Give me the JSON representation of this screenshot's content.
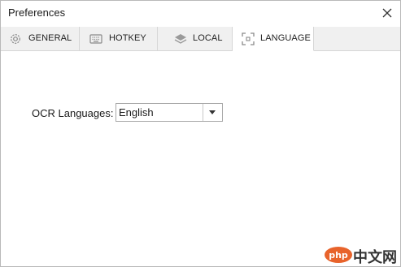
{
  "window": {
    "title": "Preferences"
  },
  "tabs": [
    {
      "label": "GENERAL",
      "icon": "gear-icon",
      "active": false
    },
    {
      "label": "HOTKEY",
      "icon": "keyboard-icon",
      "active": false
    },
    {
      "label": "LOCAL",
      "icon": "layers-icon",
      "active": false
    },
    {
      "label": "LANGUAGE",
      "icon": "scan-frame-icon",
      "active": true
    }
  ],
  "language": {
    "ocr_label": "OCR Languages:",
    "selected": "English"
  },
  "watermark": {
    "text": "中文网"
  }
}
